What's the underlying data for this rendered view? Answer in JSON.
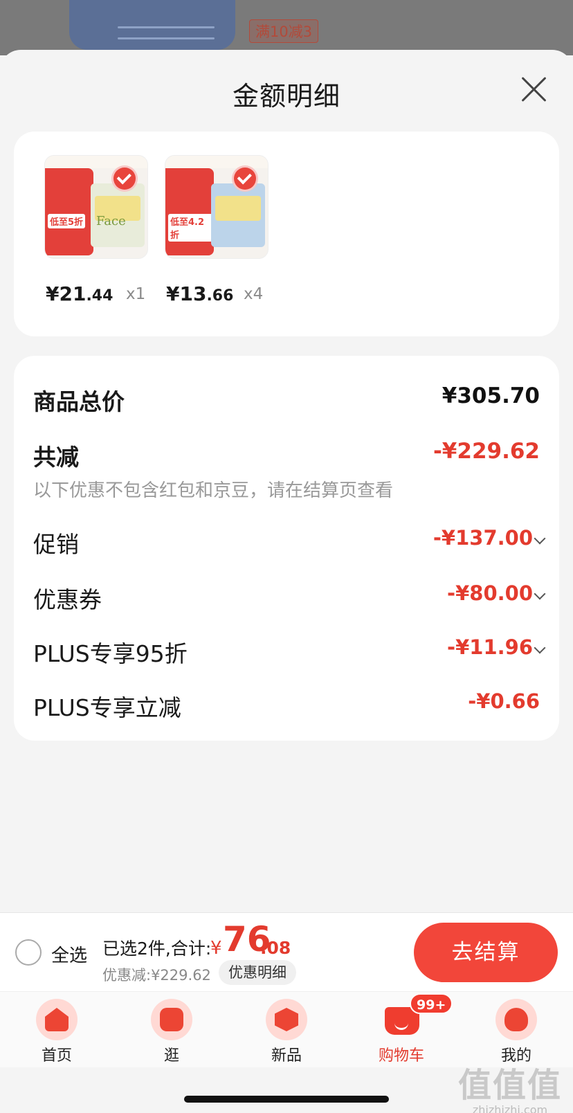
{
  "background": {
    "tags": [
      "满10减3"
    ]
  },
  "sheet": {
    "title": "金额明细"
  },
  "items": [
    {
      "price_int": "¥21",
      "price_dec": ".44",
      "qty": "x1",
      "badge_text": "低至5折"
    },
    {
      "price_int": "¥13",
      "price_dec": ".66",
      "qty": "x4",
      "badge_text": "低至4.2折"
    }
  ],
  "detail": {
    "total_label": "商品总价",
    "total_value": "¥305.70",
    "reduce_label": "共减",
    "reduce_value": "-¥229.62",
    "note": "以下优惠不包含红包和京豆，请在结算页查看",
    "rows": [
      {
        "label": "促销",
        "value": "-¥137.00"
      },
      {
        "label": "优惠券",
        "value": "-¥80.00"
      },
      {
        "label": "PLUS专享95折",
        "value": "-¥11.96"
      },
      {
        "label": "PLUS专享立减",
        "value": "-¥0.66"
      }
    ]
  },
  "checkout": {
    "select_all": "全选",
    "selected_info": "已选2件,合计:",
    "total_yen": "¥",
    "total_int": "76",
    "total_dec": ".08",
    "saved": "优惠减:¥229.62",
    "detail_button": "优惠明细",
    "checkout_button": "去结算"
  },
  "tabbar": {
    "tabs": [
      {
        "label": "首页",
        "icon": "home-icon"
      },
      {
        "label": "逛",
        "icon": "browse-icon"
      },
      {
        "label": "新品",
        "icon": "new-products-icon"
      },
      {
        "label": "购物车",
        "icon": "cart-icon",
        "active": true
      },
      {
        "label": "我的",
        "icon": "profile-icon"
      }
    ],
    "cart_badge": "99+"
  },
  "watermark": {
    "big": "值值值",
    "small": "zhizhizhi.com"
  },
  "colors": {
    "accent": "#e33b2e",
    "checkout_button": "#f2463a"
  }
}
